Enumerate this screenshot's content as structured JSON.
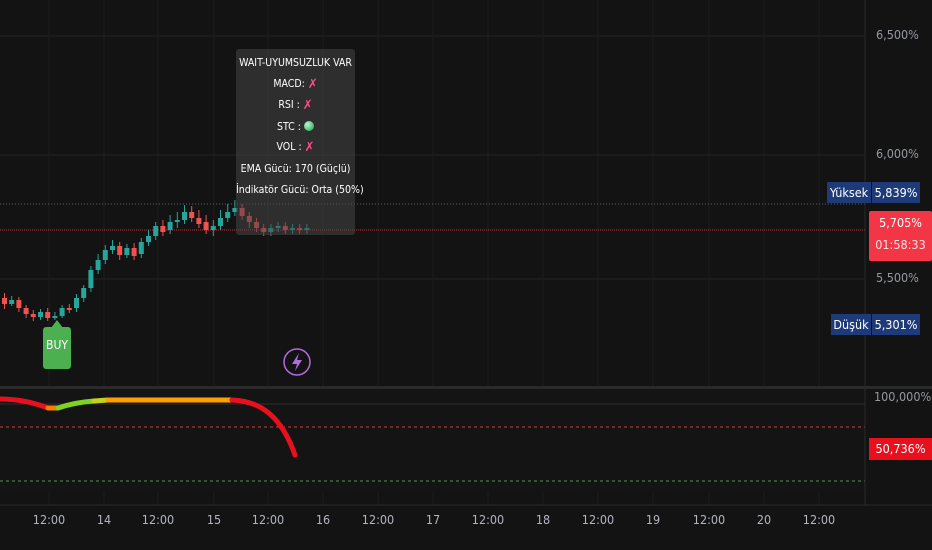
{
  "price_axis": {
    "ticks": [
      {
        "label": "6,500%",
        "value": 6.5
      },
      {
        "label": "6,000%",
        "value": 6.0
      },
      {
        "label": "5,500%",
        "value": 5.5
      }
    ],
    "high_label": "Yüksek",
    "high_value": "5,839%",
    "current_value": "5,705%",
    "countdown": "01:58:33",
    "low_label": "Düşük",
    "low_value": "5,301%"
  },
  "indicator_axis": {
    "top_label": "100,000%",
    "current_value": "50,736%"
  },
  "time_axis": [
    "12:00",
    "14",
    "12:00",
    "15",
    "12:00",
    "16",
    "12:00",
    "17",
    "12:00",
    "18",
    "12:00",
    "19",
    "12:00",
    "20",
    "12:00"
  ],
  "signal_panel": {
    "title": "WAIT-UYUMSUZLUK VAR",
    "rows": [
      {
        "label": "MACD:",
        "status": "fail"
      },
      {
        "label": "RSI :",
        "status": "fail"
      },
      {
        "label": "STC :",
        "status": "pass"
      },
      {
        "label": "VOL :",
        "status": "fail"
      }
    ],
    "ema_strength": "EMA Gücü: 170 (Güçlü)",
    "indicator_strength": "İndikatör Gücü: Orta (50%)"
  },
  "buy_signal": {
    "label": "BUY"
  },
  "colors": {
    "up": "#26a69a",
    "down": "#ef5350",
    "current_price": "#f23645",
    "label_blue": "#1e3a78",
    "buy": "#4caf50",
    "lightning": "#b46ae0"
  },
  "icons": {
    "event": "lightning-icon",
    "fail": "x-mark-icon",
    "pass": "green-dot-icon"
  }
}
